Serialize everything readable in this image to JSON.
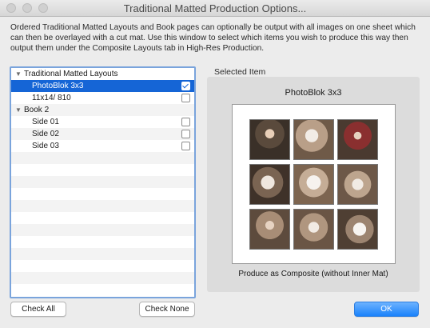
{
  "window": {
    "title": "Traditional Matted Production Options..."
  },
  "description": "Ordered Traditional Matted Layouts and Book pages can optionally be output with all images on one sheet which can then be overlayed with a cut mat. Use this window to select which items you wish to produce this way then output them under the Composite Layouts tab in High-Res Production.",
  "tree": {
    "group1": {
      "label": "Traditional Matted Layouts",
      "expanded": true
    },
    "item1": {
      "label": "PhotoBlok 3x3",
      "checked": true,
      "selected": true
    },
    "item2": {
      "label": "11x14/ 810",
      "checked": false
    },
    "group2": {
      "label": "Book 2",
      "expanded": true
    },
    "item3": {
      "label": "Side 01",
      "checked": false
    },
    "item4": {
      "label": "Side 02",
      "checked": false
    },
    "item5": {
      "label": "Side 03",
      "checked": false
    }
  },
  "selected_item": {
    "section_label": "Selected Item",
    "name": "PhotoBlok 3x3",
    "produce_label": "Produce as Composite (without Inner Mat)"
  },
  "buttons": {
    "check_all": "Check All",
    "check_none": "Check None",
    "ok": "OK"
  },
  "icons": {
    "expand": "disclosure-triangle-icon",
    "check": "checkmark-icon"
  },
  "colors": {
    "selection": "#1565d6",
    "focus_ring": "#7aa4dc",
    "ok_button": "#1a82fb"
  }
}
